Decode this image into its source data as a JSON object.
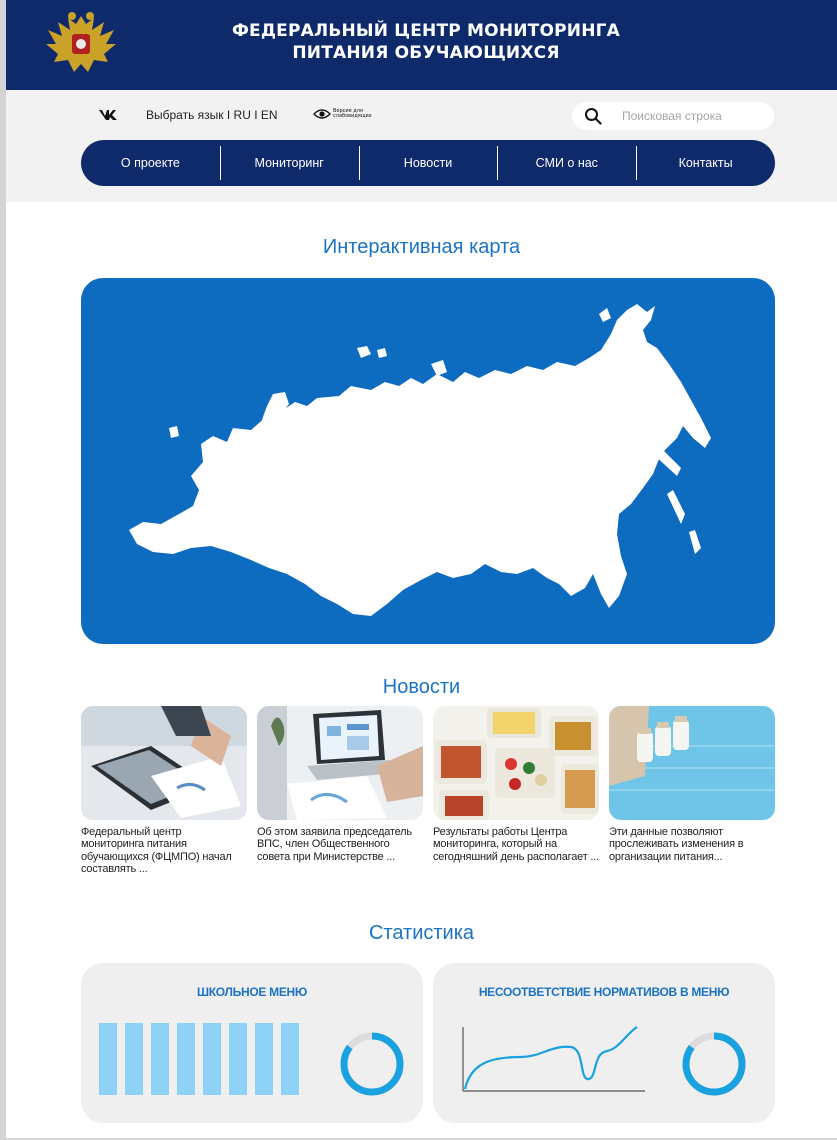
{
  "header": {
    "title_line1": "ФЕДЕРАЛЬНЫЙ ЦЕНТР МОНИТОРИНГА",
    "title_line2": "ПИТАНИЯ ОБУЧАЮЩИХСЯ",
    "emblem_icon": "double-headed-eagle-emblem"
  },
  "topbar": {
    "vk_label": "VK",
    "lang_label": "Выбрать язык I RU I EN",
    "vision_label_line1": "Версия для",
    "vision_label_line2": "слабовидящих",
    "vision_icon": "eye-icon",
    "search_placeholder": "Поисковая строка",
    "search_icon": "search-icon"
  },
  "nav": {
    "items": [
      {
        "label": "О проекте"
      },
      {
        "label": "Мониторинг"
      },
      {
        "label": "Новости"
      },
      {
        "label": "СМИ о нас"
      },
      {
        "label": "Контакты"
      }
    ]
  },
  "map_section": {
    "title": "Интерактивная карта"
  },
  "news_section": {
    "title": "Новости",
    "items": [
      {
        "text": "Федеральный центр мониторинга питания обучающихся (ФЦМПО) начал составлять ...",
        "image": "documents-and-laptop-photo"
      },
      {
        "text": "Об этом заявила председатель ВПС, член Общественного совета при Министерстве ...",
        "image": "laptop-charts-photo"
      },
      {
        "text": "Результаты работы Центра мониторинга, который на сегодняшний день располагает ...",
        "image": "meal-containers-photo"
      },
      {
        "text": "Эти данные позволяют прослеживать изменения в организации питания...",
        "image": "milk-bottles-photo"
      }
    ]
  },
  "stats_section": {
    "title": "Статистика",
    "cards": [
      {
        "title": "ШКОЛЬНОЕ МЕНЮ",
        "chart": "bar-chart-icon",
        "donut": "donut-chart-icon"
      },
      {
        "title": "НЕСООТВЕТСТВИЕ НОРМАТИВОВ В МЕНЮ",
        "chart": "line-chart-icon",
        "donut": "donut-chart-icon"
      }
    ]
  },
  "colors": {
    "navy": "#0e2a6b",
    "accent_blue": "#1a73c4",
    "map_blue": "#0d6bc0",
    "light_blue": "#8ed2f7"
  }
}
